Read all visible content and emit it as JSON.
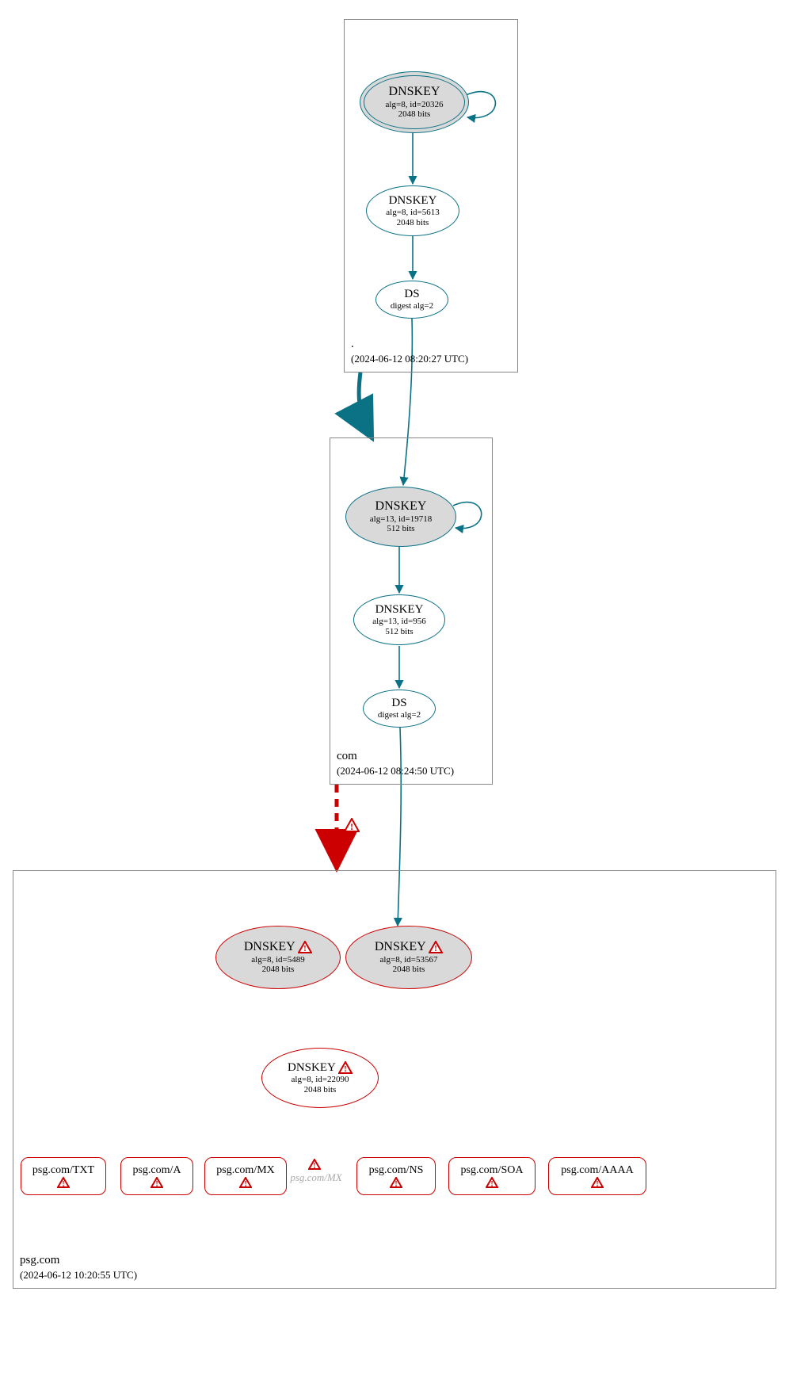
{
  "zones": {
    "root": {
      "name": ".",
      "timestamp": "(2024-06-12 08:20:27 UTC)"
    },
    "com": {
      "name": "com",
      "timestamp": "(2024-06-12 08:24:50 UTC)"
    },
    "psg": {
      "name": "psg.com",
      "timestamp": "(2024-06-12 10:20:55 UTC)"
    }
  },
  "nodes": {
    "root_ksk": {
      "title": "DNSKEY",
      "line2": "alg=8, id=20326",
      "line3": "2048 bits"
    },
    "root_zsk": {
      "title": "DNSKEY",
      "line2": "alg=8, id=5613",
      "line3": "2048 bits"
    },
    "root_ds": {
      "title": "DS",
      "line2": "digest alg=2"
    },
    "com_ksk": {
      "title": "DNSKEY",
      "line2": "alg=13, id=19718",
      "line3": "512 bits"
    },
    "com_zsk": {
      "title": "DNSKEY",
      "line2": "alg=13, id=956",
      "line3": "512 bits"
    },
    "com_ds": {
      "title": "DS",
      "line2": "digest alg=2"
    },
    "psg_k1": {
      "title": "DNSKEY",
      "line2": "alg=8, id=5489",
      "line3": "2048 bits"
    },
    "psg_k2": {
      "title": "DNSKEY",
      "line2": "alg=8, id=53567",
      "line3": "2048 bits"
    },
    "psg_k3": {
      "title": "DNSKEY",
      "line2": "alg=8, id=22090",
      "line3": "2048 bits"
    }
  },
  "rr": {
    "txt": "psg.com/TXT",
    "a": "psg.com/A",
    "mx": "psg.com/MX",
    "ns": "psg.com/NS",
    "soa": "psg.com/SOA",
    "aaaa": "psg.com/AAAA",
    "mx_ghost": "psg.com/MX"
  }
}
